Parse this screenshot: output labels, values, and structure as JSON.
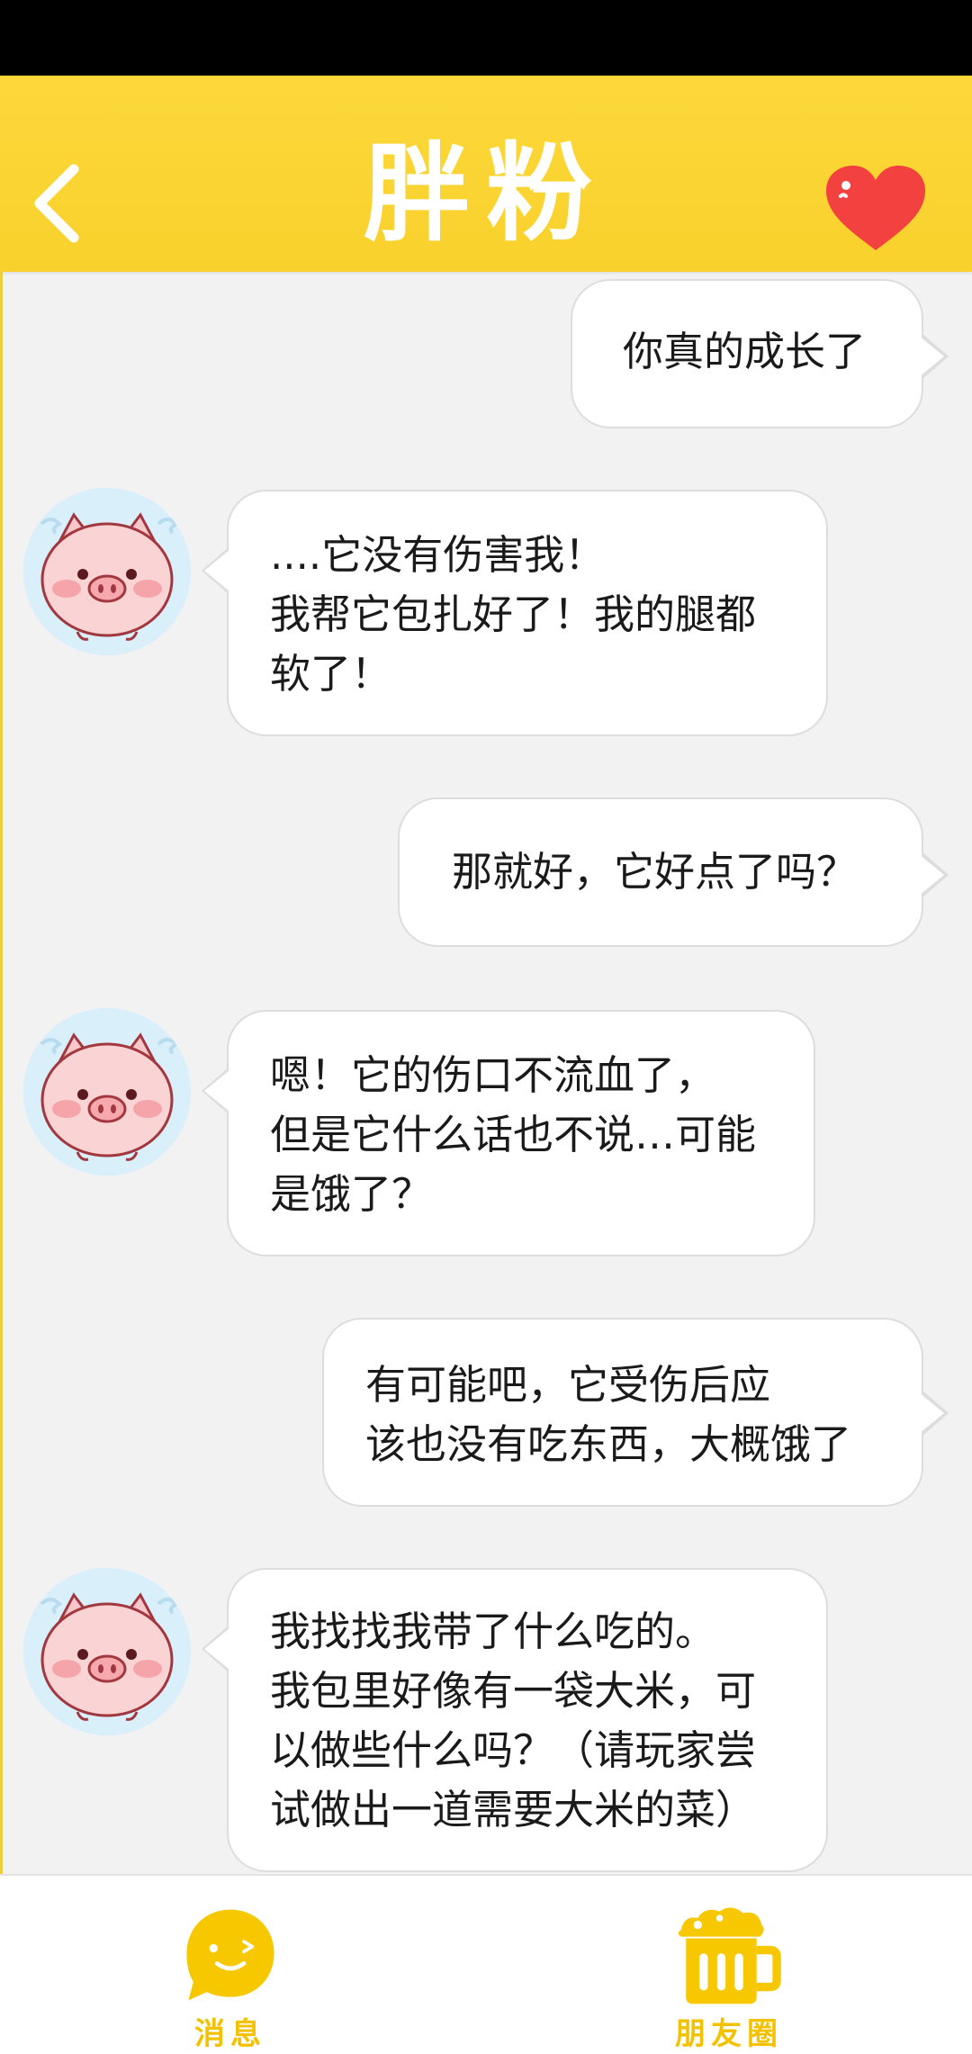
{
  "header": {
    "title": "胖粉"
  },
  "messages": [
    {
      "side": "right",
      "text": "你真的成长了"
    },
    {
      "side": "left",
      "text": "....它没有伤害我！\n我帮它包扎好了！我的腿都\n软了！"
    },
    {
      "side": "right",
      "text": "那就好，它好点了吗？"
    },
    {
      "side": "left",
      "text": "嗯！它的伤口不流血了，\n但是它什么话也不说…可能\n是饿了？"
    },
    {
      "side": "right",
      "text": " 有可能吧，它受伤后应\n该也没有吃东西，大概饿了"
    },
    {
      "side": "left",
      "text": "我找找我带了什么吃的。\n我包里好像有一袋大米，可\n以做些什么吗？（请玩家尝\n试做出一道需要大米的菜）"
    }
  ],
  "tabbar": {
    "messages_label": "消息",
    "moments_label": "朋友圈"
  },
  "colors": {
    "header": "#f9d12c",
    "tab_accent": "#f2c200",
    "heart": "#f2413f"
  }
}
